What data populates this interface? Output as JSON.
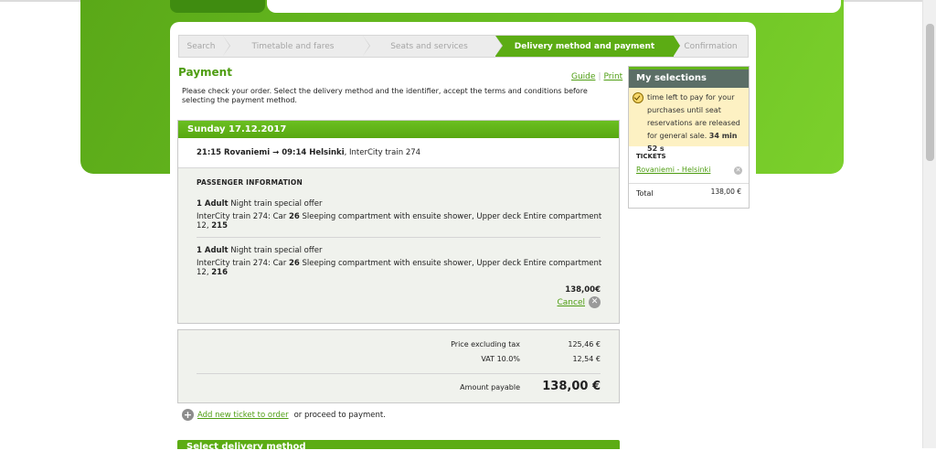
{
  "steps": [
    {
      "label": "Search",
      "active": false
    },
    {
      "label": "Timetable and fares",
      "active": false
    },
    {
      "label": "Seats and services",
      "active": false
    },
    {
      "label": "Delivery method and payment",
      "active": true
    },
    {
      "label": "Confirmation",
      "active": false
    }
  ],
  "page": {
    "title": "Payment",
    "guide_link": "Guide",
    "print_link": "Print",
    "intro": "Please check your order. Select the delivery method and the identifier, accept the terms and conditions before selecting the payment method."
  },
  "journey": {
    "date": "Sunday 17.12.2017",
    "route_bold": "21:15 Rovaniemi → 09:14 Helsinki",
    "route_train": ", InterCity train 274",
    "passenger_header": "PASSENGER INFORMATION",
    "passengers": [
      {
        "qty": "1 Adult",
        "fare": " Night train special offer",
        "seat_prefix": "InterCity train 274: Car ",
        "car": "26",
        "seat_mid": " Sleeping compartment with ensuite shower, Upper deck Entire compartment 12, ",
        "seat": "215"
      },
      {
        "qty": "1 Adult",
        "fare": " Night train special offer",
        "seat_prefix": "InterCity train 274: Car ",
        "car": "26",
        "seat_mid": " Sleeping compartment with ensuite shower, Upper deck Entire compartment 12, ",
        "seat": "216"
      }
    ],
    "price": "138,00€",
    "cancel_label": "Cancel"
  },
  "totals": {
    "excl_tax_label": "Price excluding tax",
    "excl_tax_value": "125,46 €",
    "vat_label": "VAT 10.0%",
    "vat_value": "12,54 €",
    "payable_label": "Amount payable",
    "payable_value": "138,00 €"
  },
  "add_ticket": {
    "link": "Add new ticket to order",
    "suffix": "or proceed to payment."
  },
  "next_section": {
    "title": "Select delivery method"
  },
  "side": {
    "title": "My selections",
    "timer_text": "time left to pay for your purchases until seat reservations are released for general sale.",
    "timer_value": "34 min 52 s",
    "tickets_label": "TICKETS",
    "ticket_link": "Rovaniemi - Helsinki",
    "total_label": "Total",
    "total_value": "138,00 €"
  },
  "colors": {
    "brand_green": "#5cac14",
    "side_header": "#5b6e66",
    "timer_bg": "#fdf1c3"
  }
}
